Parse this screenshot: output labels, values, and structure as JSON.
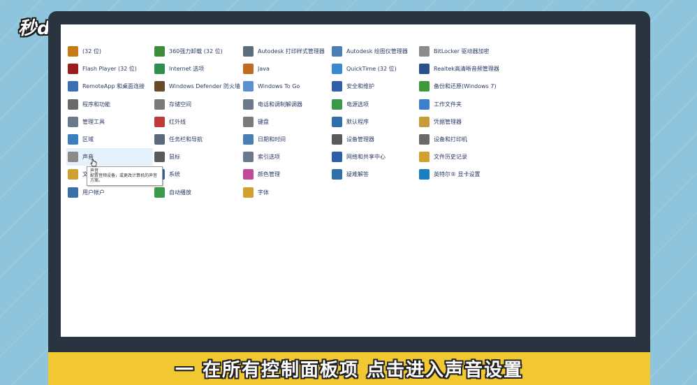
{
  "logo": {
    "text": "秒dong视频"
  },
  "subtitle": "一 在所有控制面板项 点击进入声音设置",
  "control_panel": {
    "items": [
      {
        "label": "(32 位)",
        "icon": "java-cup-icon",
        "color": "#c77b16"
      },
      {
        "label": "360强力卸载 (32 位)",
        "icon": "uninstall-icon",
        "color": "#3b8c3b"
      },
      {
        "label": "Autodesk 打印样式管理器",
        "icon": "printer-icon",
        "color": "#5a6d7d"
      },
      {
        "label": "Autodesk 绘图仪管理器",
        "icon": "plotter-icon",
        "color": "#4a7fb5"
      },
      {
        "label": "BitLocker 驱动器加密",
        "icon": "bitlocker-icon",
        "color": "#8c8c8c"
      },
      {
        "label": "Flash Player (32 位)",
        "icon": "flash-icon",
        "color": "#9b1c1c"
      },
      {
        "label": "Internet 选项",
        "icon": "globe-icon",
        "color": "#2f8f4f"
      },
      {
        "label": "Java",
        "icon": "java-icon",
        "color": "#c06a22"
      },
      {
        "label": "QuickTime (32 位)",
        "icon": "quicktime-icon",
        "color": "#3a88d0"
      },
      {
        "label": "Realtek高清晰音频管理器",
        "icon": "speaker-icon",
        "color": "#2a4f8c"
      },
      {
        "label": "RemoteApp 和桌面连接",
        "icon": "remote-desktop-icon",
        "color": "#3a6fb5"
      },
      {
        "label": "Windows Defender 防火墙",
        "icon": "firewall-icon",
        "color": "#6b4a2a"
      },
      {
        "label": "Windows To Go",
        "icon": "usb-drive-icon",
        "color": "#5a8fd0"
      },
      {
        "label": "安全和维护",
        "icon": "flag-icon",
        "color": "#2f5faa"
      },
      {
        "label": "备份和还原(Windows 7)",
        "icon": "backup-icon",
        "color": "#3c9a3c"
      },
      {
        "label": "程序和功能",
        "icon": "programs-icon",
        "color": "#6a6a6a"
      },
      {
        "label": "存储空间",
        "icon": "storage-icon",
        "color": "#7a7a7a"
      },
      {
        "label": "电话和调制解调器",
        "icon": "phone-modem-icon",
        "color": "#6a7a8a"
      },
      {
        "label": "电源选项",
        "icon": "power-icon",
        "color": "#3a9a4a"
      },
      {
        "label": "工作文件夹",
        "icon": "work-folder-icon",
        "color": "#3a7fd0"
      },
      {
        "label": "管理工具",
        "icon": "admin-tools-icon",
        "color": "#6a7a8a"
      },
      {
        "label": "红外线",
        "icon": "infrared-icon",
        "color": "#c03a3a"
      },
      {
        "label": "键盘",
        "icon": "keyboard-icon",
        "color": "#7a7a7a"
      },
      {
        "label": "默认程序",
        "icon": "default-programs-icon",
        "color": "#2f6faa"
      },
      {
        "label": "凭据管理器",
        "icon": "credential-icon",
        "color": "#c79a3a"
      },
      {
        "label": "区域",
        "icon": "region-icon",
        "color": "#3a7fbf"
      },
      {
        "label": "任务栏和导航",
        "icon": "taskbar-icon",
        "color": "#5a6a7a"
      },
      {
        "label": "日期和时间",
        "icon": "clock-icon",
        "color": "#4a7fb5"
      },
      {
        "label": "设备管理器",
        "icon": "device-manager-icon",
        "color": "#5a5a5a"
      },
      {
        "label": "设备和打印机",
        "icon": "devices-printers-icon",
        "color": "#6a6a6a"
      },
      {
        "label": "声音",
        "icon": "sound-icon",
        "color": "#8a8a8a"
      },
      {
        "label": "鼠标",
        "icon": "mouse-icon",
        "color": "#5a5a5a"
      },
      {
        "label": "索引选项",
        "icon": "index-icon",
        "color": "#6a7a8a"
      },
      {
        "label": "网络和共享中心",
        "icon": "network-icon",
        "color": "#2f5faa"
      },
      {
        "label": "文件历史记录",
        "icon": "file-history-icon",
        "color": "#d0a030"
      },
      {
        "label": "文件资源管理器选项",
        "icon": "folder-options-icon",
        "color": "#d0a030"
      },
      {
        "label": "系统",
        "icon": "system-icon",
        "color": "#3a6faa"
      },
      {
        "label": "颜色管理",
        "icon": "color-management-icon",
        "color": "#c04a9a"
      },
      {
        "label": "疑难解答",
        "icon": "troubleshoot-icon",
        "color": "#2f6faa"
      },
      {
        "label": "英特尔® 显卡设置",
        "icon": "intel-graphics-icon",
        "color": "#1a7fc0"
      },
      {
        "label": "用户帐户",
        "icon": "user-accounts-icon",
        "color": "#3a6faa"
      },
      {
        "label": "自动播放",
        "icon": "autoplay-icon",
        "color": "#3a9a4a"
      },
      {
        "label": "字体",
        "icon": "font-icon",
        "color": "#d0a030"
      }
    ]
  },
  "tooltip": {
    "title": "声音",
    "text": "配置音频设备，或更改计算机的声音方案。"
  }
}
